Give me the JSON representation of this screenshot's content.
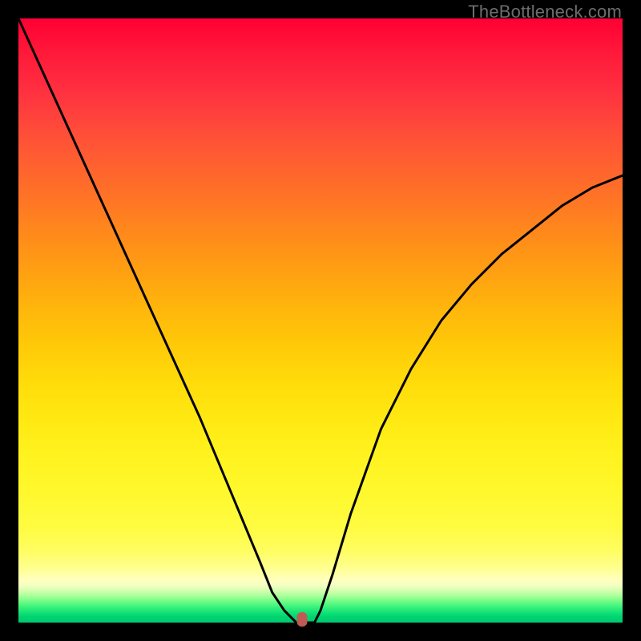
{
  "watermark": "TheBottleneck.com",
  "chart_data": {
    "type": "line",
    "title": "",
    "xlabel": "",
    "ylabel": "",
    "xlim": [
      0,
      100
    ],
    "ylim": [
      0,
      100
    ],
    "x": [
      0,
      5,
      10,
      15,
      20,
      25,
      30,
      35,
      40,
      42,
      44,
      46,
      48,
      49,
      50,
      52,
      55,
      60,
      65,
      70,
      75,
      80,
      85,
      90,
      95,
      100
    ],
    "values": [
      100,
      89,
      78,
      67,
      56,
      45,
      34,
      22,
      10,
      5,
      2,
      0,
      0,
      0,
      2,
      8,
      18,
      32,
      42,
      50,
      56,
      61,
      65,
      69,
      72,
      74
    ],
    "marker": {
      "x": 47,
      "y": 0
    },
    "background": "rainbow-gradient-vertical",
    "annotations": [
      "TheBottleneck.com"
    ]
  }
}
